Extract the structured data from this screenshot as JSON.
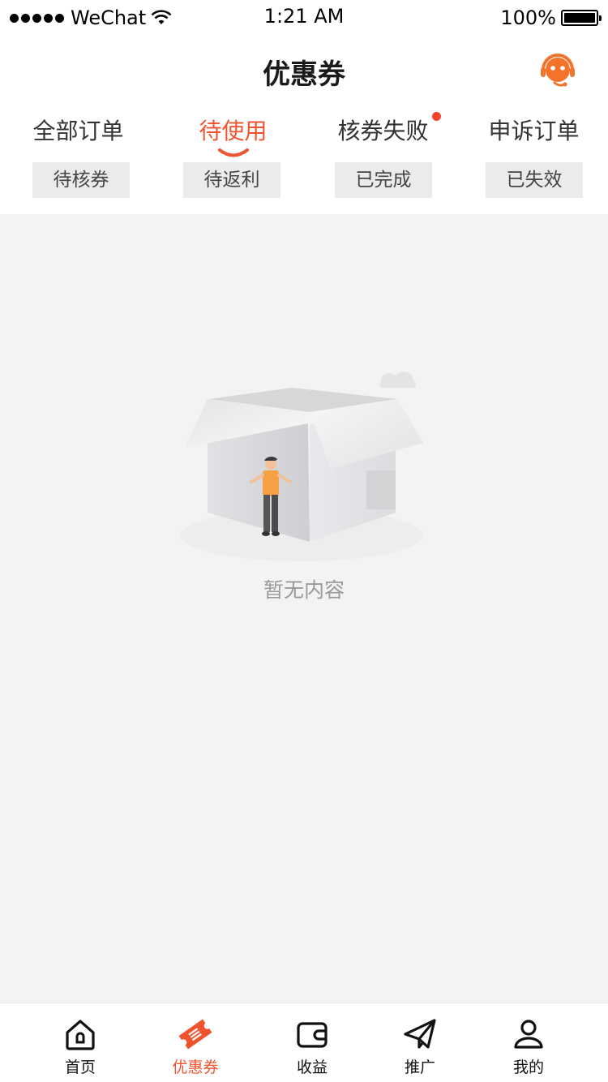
{
  "status_bar": {
    "carrier": "WeChat",
    "time": "1:21 AM",
    "battery": "100%"
  },
  "header": {
    "title": "优惠券",
    "service_icon": "customer-service-icon"
  },
  "order_tabs": [
    {
      "label": "全部订单",
      "active": false,
      "badge": false
    },
    {
      "label": "待使用",
      "active": true,
      "badge": false
    },
    {
      "label": "核券失败",
      "active": false,
      "badge": true
    },
    {
      "label": "申诉订单",
      "active": false,
      "badge": false
    }
  ],
  "status_filters": [
    "待核券",
    "待返利",
    "已完成",
    "已失效"
  ],
  "empty_state": {
    "message": "暂无内容",
    "illustration": "empty-box-illustration"
  },
  "bottom_nav": [
    {
      "label": "首页",
      "icon": "home-icon",
      "active": false
    },
    {
      "label": "优惠券",
      "icon": "coupon-icon",
      "active": true
    },
    {
      "label": "收益",
      "icon": "wallet-icon",
      "active": false
    },
    {
      "label": "推广",
      "icon": "paper-plane-icon",
      "active": false
    },
    {
      "label": "我的",
      "icon": "user-icon",
      "active": false
    }
  ],
  "colors": {
    "accent": "#f0532f",
    "background": "#f3f3f3",
    "chip_bg": "#ebebeb"
  }
}
